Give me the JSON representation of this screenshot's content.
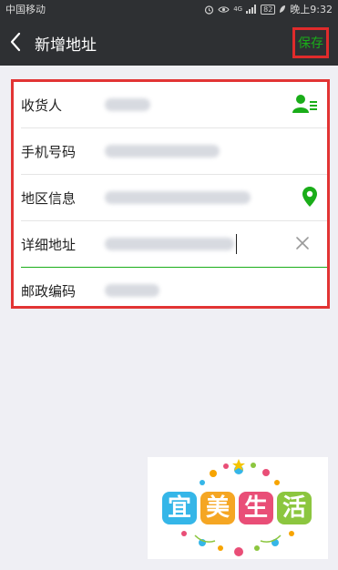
{
  "status_bar": {
    "carrier": "中国移动",
    "time": "晚上9:32",
    "battery": "82",
    "network": "4G"
  },
  "header": {
    "title": "新增地址",
    "save_label": "保存"
  },
  "form": {
    "fields": [
      {
        "label": "收货人",
        "action_icon": "contacts-icon"
      },
      {
        "label": "手机号码"
      },
      {
        "label": "地区信息",
        "action_icon": "location-pin-icon"
      },
      {
        "label": "详细地址",
        "action_icon": "clear-icon"
      },
      {
        "label": "邮政编码"
      }
    ]
  },
  "logo": {
    "text": "宜美生活",
    "colors": [
      "#35b6e8",
      "#f5a623",
      "#e94e77",
      "#8cc63f"
    ]
  },
  "colors": {
    "accent": "#1aad19",
    "header_bg": "#2e3033",
    "highlight": "#e02b2b"
  }
}
